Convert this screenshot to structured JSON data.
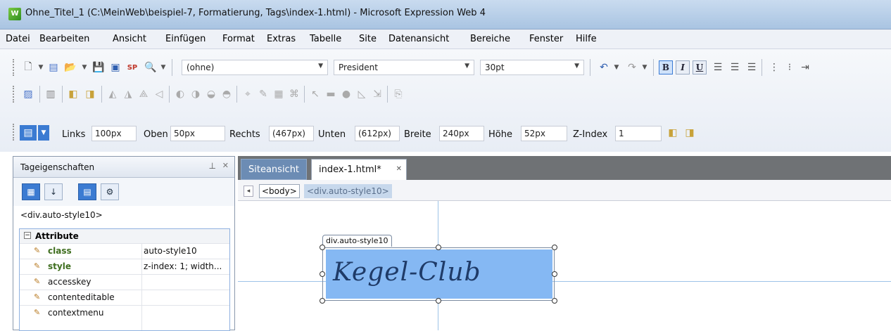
{
  "window": {
    "title": "Ohne_Titel_1 (C:\\MeinWeb\\beispiel-7, Formatierung, Tags\\index-1.html) - Microsoft Expression Web 4",
    "logo_text": "W"
  },
  "menu": [
    "Datei",
    "Bearbeiten",
    "Ansicht",
    "Einfügen",
    "Format",
    "Extras",
    "Tabelle",
    "Site",
    "Datenansicht",
    "Bereiche",
    "Fenster",
    "Hilfe"
  ],
  "toolbar": {
    "style_combo": "(ohne)",
    "font_combo": "President",
    "size_combo": "30pt",
    "bold": "B",
    "italic": "I",
    "underline": "U"
  },
  "position_bar": {
    "links_label": "Links",
    "links_value": "100px",
    "oben_label": "Oben",
    "oben_value": "50px",
    "rechts_label": "Rechts",
    "rechts_value": "(467px)",
    "unten_label": "Unten",
    "unten_value": "(612px)",
    "breite_label": "Breite",
    "breite_value": "240px",
    "hoehe_label": "Höhe",
    "hoehe_value": "52px",
    "zindex_label": "Z-Index",
    "zindex_value": "1"
  },
  "panel": {
    "title": "Tageigenschaften",
    "tag": "<div.auto-style10>",
    "group": "Attribute",
    "rows": [
      {
        "name": "class",
        "value": "auto-style10"
      },
      {
        "name": "style",
        "value": "z-index: 1; width..."
      },
      {
        "name": "accesskey",
        "value": ""
      },
      {
        "name": "contenteditable",
        "value": ""
      },
      {
        "name": "contextmenu",
        "value": ""
      }
    ]
  },
  "editor": {
    "tabs": [
      "Siteansicht",
      "index-1.html*"
    ],
    "crumbs": [
      "<body>",
      "<div.auto-style10>"
    ],
    "div_label": "div.auto-style10",
    "div_text": "Kegel-Club"
  },
  "colors": {
    "div_fill": "#85b8f3",
    "active_tab_bg": "#ffffff",
    "editor_bg": "#6f7275"
  },
  "icons": [
    "new-page-icon",
    "open-icon",
    "save-icon",
    "publish-icon",
    "preview-icon",
    "undo-icon",
    "redo-icon",
    "align-left-icon",
    "align-center-icon",
    "align-right-icon",
    "numbered-list-icon",
    "bullet-list-icon",
    "pin-icon",
    "close-icon"
  ]
}
